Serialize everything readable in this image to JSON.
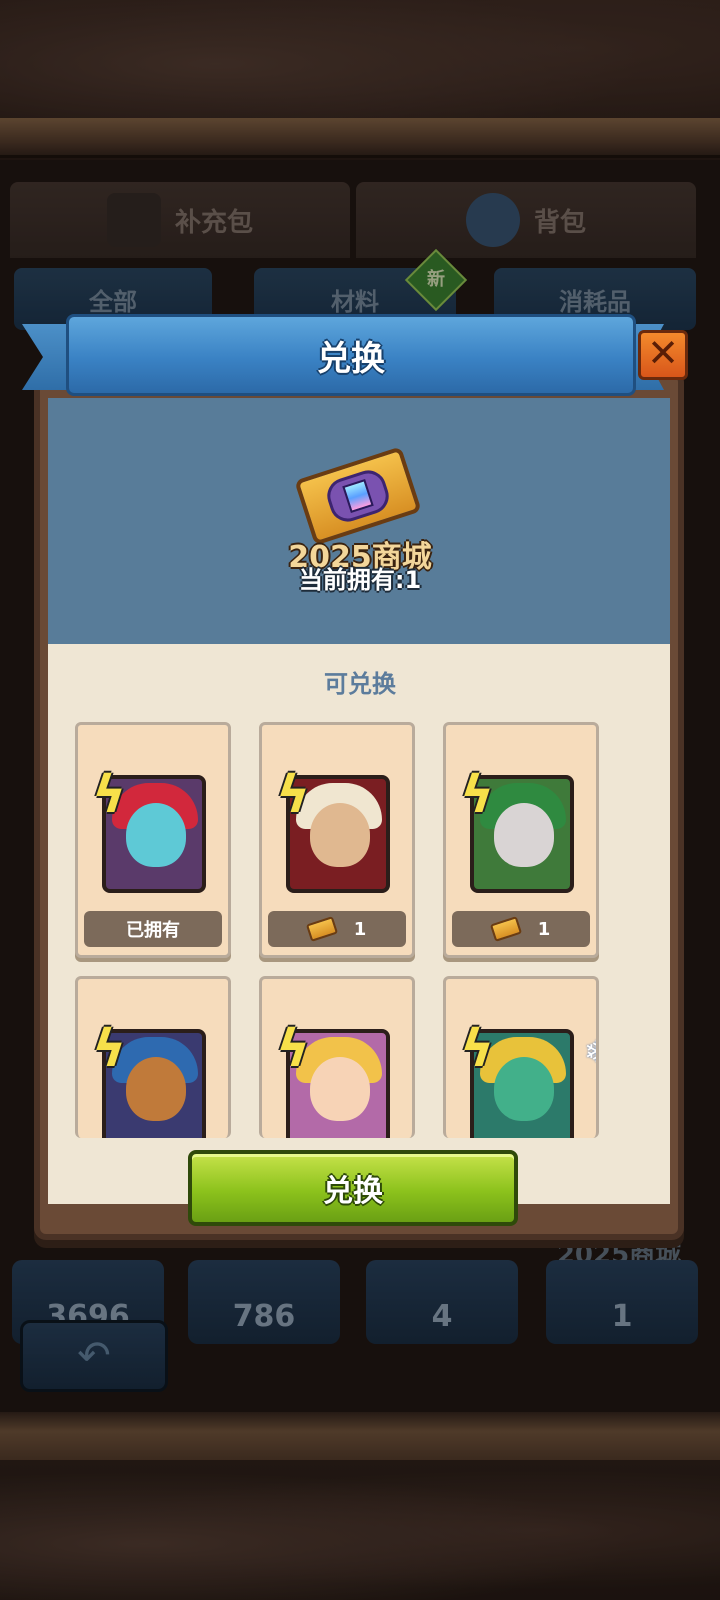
{
  "background": {
    "tabs": [
      {
        "label": "补充包",
        "icon": "card-pack-icon"
      },
      {
        "label": "背包",
        "icon": "potion-bag-icon"
      }
    ],
    "sub_tabs": [
      "全部",
      "材料",
      "消耗品"
    ],
    "new_badge": "新",
    "resources": [
      "3696",
      "786",
      "4",
      "1"
    ],
    "resource_label": "2025商城",
    "back_icon": "back-arrow-icon"
  },
  "modal": {
    "title": "兑换",
    "close_icon": "close-icon",
    "item_name": "2025商城",
    "owned_text": "当前拥有:1",
    "section_title": "可兑换",
    "exchange_button": "兑换",
    "cards": [
      {
        "name": "hero-card-demon",
        "status": "已拥有",
        "cost": null,
        "colors": {
          "bg": "#5a3a6a",
          "face": "#5ec9d6",
          "hair": "#d2283c"
        }
      },
      {
        "name": "hero-card-warlord",
        "status": null,
        "cost": "1",
        "colors": {
          "bg": "#7a1e22",
          "face": "#e0b890",
          "hair": "#f0e6d0"
        }
      },
      {
        "name": "hero-card-beast-trio",
        "status": null,
        "cost": "1",
        "colors": {
          "bg": "#3f7a3a",
          "face": "#d9d4d4",
          "hair": "#2f8a40"
        }
      },
      {
        "name": "hero-card-bull",
        "status": null,
        "cost": null,
        "colors": {
          "bg": "#3a3a70",
          "face": "#c07a3a",
          "hair": "#2e6ab0"
        }
      },
      {
        "name": "hero-card-lady",
        "status": null,
        "cost": null,
        "colors": {
          "bg": "#b36aa8",
          "face": "#f7d3b6",
          "hair": "#f2c24a"
        }
      },
      {
        "name": "hero-card-dragon",
        "status": null,
        "cost": null,
        "colors": {
          "bg": "#2c7a6a",
          "face": "#42b08a",
          "hair": "#e8c23a"
        }
      }
    ]
  }
}
